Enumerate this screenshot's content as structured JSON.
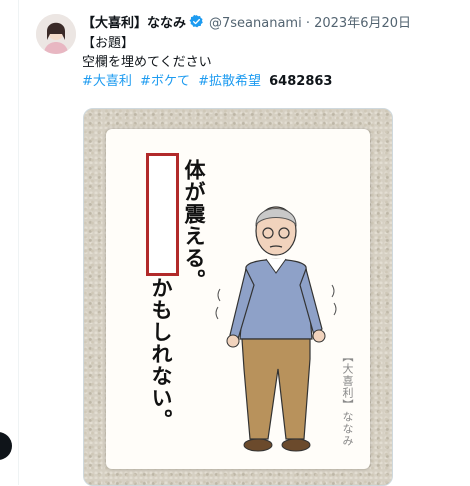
{
  "tweet": {
    "display_name": "【大喜利】ななみ",
    "handle_date": "@7seananami · 2023年6月20日",
    "line1": "【お題】",
    "line2": "空欄を埋めてください",
    "hashtags": [
      "#大喜利",
      "#ボケて",
      "#拡散希望"
    ],
    "count": "6482863"
  },
  "card": {
    "text_top": "体が震える。",
    "text_bottom": "かもしれない。",
    "credit": "【大喜利】ななみ"
  },
  "colors": {
    "accent": "#1d9bf0",
    "verified": "#1d9bf0",
    "blank_border": "#b12a2a"
  }
}
